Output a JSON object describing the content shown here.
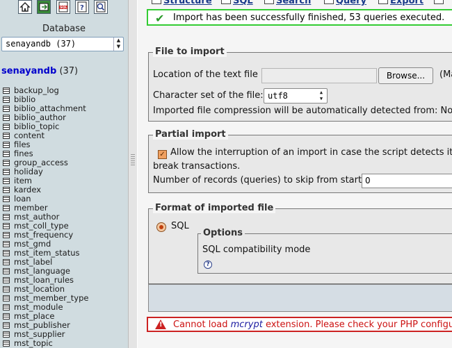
{
  "nav": {
    "toolbar_icons": [
      "home-icon",
      "exit-icon",
      "sql-query-icon",
      "docs-help-icon",
      "phpmyadmin-docs-icon"
    ],
    "database_caption": "Database",
    "database_select_value": "senayandb (37)",
    "db_name": "senayandb",
    "db_count": "(37)",
    "tables": [
      "backup_log",
      "biblio",
      "biblio_attachment",
      "biblio_author",
      "biblio_topic",
      "content",
      "files",
      "fines",
      "group_access",
      "holiday",
      "item",
      "kardex",
      "loan",
      "member",
      "mst_author",
      "mst_coll_type",
      "mst_frequency",
      "mst_gmd",
      "mst_item_status",
      "mst_label",
      "mst_language",
      "mst_loan_rules",
      "mst_location",
      "mst_member_type",
      "mst_module",
      "mst_place",
      "mst_publisher",
      "mst_supplier",
      "mst_topic"
    ]
  },
  "tabs": [
    "Structure",
    "SQL",
    "Search",
    "Query",
    "Export"
  ],
  "success_message": "Import has been successfully finished, 53 queries executed.",
  "file_import": {
    "legend": "File to import",
    "location_label": "Location of the text file",
    "browse_label": "Browse...",
    "browse_suffix": "(Ma",
    "charset_label": "Character set of the file:",
    "charset_value": "utf8",
    "compression_note": "Imported file compression will be automatically detected from: None"
  },
  "partial_import": {
    "legend": "Partial import",
    "interrupt_label_line1": "Allow the interruption of an import in case the script detects it is",
    "interrupt_label_line2": "break transactions.",
    "interrupt_checked": true,
    "skip_label": "Number of records (queries) to skip from start",
    "skip_value": "0"
  },
  "format": {
    "legend": "Format of imported file",
    "option_sql": "SQL",
    "sql_selected": true,
    "options_legend": "Options",
    "compat_label": "SQL compatibility mode",
    "help_symbol": "?"
  },
  "error": {
    "prefix": "Cannot load ",
    "link": "mcrypt",
    "suffix": " extension. Please check your PHP configur"
  },
  "colors": {
    "nav_bg": "#d0dce0",
    "success_border": "#33cc33",
    "error_border": "#cc2222",
    "db_link": "#0000cc"
  }
}
